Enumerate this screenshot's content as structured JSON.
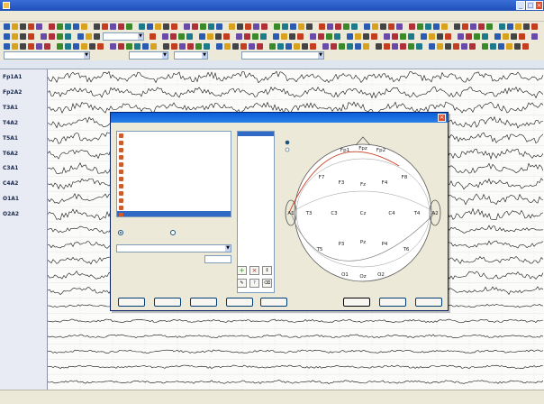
{
  "window": {
    "title": ""
  },
  "menubar": {
    "items": [
      "",
      "",
      "",
      "",
      "",
      "",
      "",
      "",
      "",
      ""
    ]
  },
  "toolbar": {
    "time_select": "",
    "record_select": "",
    "sensitivity_select": "",
    "speed_select": "",
    "montage_select": ""
  },
  "timeline": {
    "left_label": "",
    "ticks": [
      "",
      "",
      "",
      "",
      "",
      "",
      "",
      "",
      "",
      "",
      "",
      "",
      ""
    ]
  },
  "channels": [
    {
      "label": "Fp1A1"
    },
    {
      "label": "Fp2A2"
    },
    {
      "label": "T3A1"
    },
    {
      "label": "T4A2"
    },
    {
      "label": "T5A1"
    },
    {
      "label": "T6A2"
    },
    {
      "label": "C3A1"
    },
    {
      "label": "C4A2"
    },
    {
      "label": "O1A1"
    },
    {
      "label": "O2A2"
    },
    {
      "label": ""
    },
    {
      "label": ""
    },
    {
      "label": ""
    },
    {
      "label": ""
    },
    {
      "label": ""
    },
    {
      "label": ""
    },
    {
      "label": ""
    },
    {
      "label": ""
    },
    {
      "label": ""
    },
    {
      "label": ""
    },
    {
      "label": ""
    }
  ],
  "dialog": {
    "title": "",
    "montages_group_label": "",
    "montages": [
      {
        "label": ""
      },
      {
        "label": ""
      },
      {
        "label": ""
      },
      {
        "label": ""
      },
      {
        "label": ""
      },
      {
        "label": ""
      },
      {
        "label": ""
      },
      {
        "label": ""
      },
      {
        "label": ""
      },
      {
        "label": ""
      },
      {
        "label": ""
      },
      {
        "label": "",
        "selected": true
      }
    ],
    "derivations_label": "",
    "derivations": [
      "",
      "",
      "",
      "",
      "",
      "",
      "",
      "",
      "",
      "",
      "",
      "",
      "",
      "",
      "",
      "",
      "",
      "",
      "",
      "",
      "",
      "",
      "",
      "",
      "",
      "",
      "",
      "",
      "",
      "",
      "",
      "",
      "",
      "",
      "",
      "",
      "",
      "",
      "",
      "",
      "",
      "",
      "",
      "",
      "",
      ""
    ],
    "derivation_type_label": "",
    "monopolar_label": "",
    "bipolar_label": "",
    "reference_label": "",
    "reference_value": "",
    "selected_electrode_label": "",
    "device_setup_label": "",
    "device_setup_lines": [
      "",
      "",
      ""
    ],
    "current_montage_label": "",
    "small_buttons": {
      "add": "+",
      "delete": "×",
      "up": "",
      "down": ""
    },
    "hint_labels": [
      "",
      "",
      "",
      ""
    ],
    "buttons": {
      "new": "",
      "edit": "",
      "delete": "",
      "up": "",
      "down": "",
      "ok": "",
      "cancel": "",
      "help": ""
    },
    "head_options": [
      "",
      ""
    ],
    "electrodes": [
      {
        "label": "Fp1"
      },
      {
        "label": "Fp2"
      },
      {
        "label": "Fpz"
      },
      {
        "label": "F7"
      },
      {
        "label": "F3"
      },
      {
        "label": "Fz"
      },
      {
        "label": "F4"
      },
      {
        "label": "F8"
      },
      {
        "label": "A1"
      },
      {
        "label": "T3"
      },
      {
        "label": "C3"
      },
      {
        "label": "Cz"
      },
      {
        "label": "C4"
      },
      {
        "label": "T4"
      },
      {
        "label": "A2"
      },
      {
        "label": "T5"
      },
      {
        "label": "P3"
      },
      {
        "label": "Pz"
      },
      {
        "label": "P4"
      },
      {
        "label": "T6"
      },
      {
        "label": "O1"
      },
      {
        "label": "Oz"
      },
      {
        "label": "O2"
      }
    ],
    "corner_labels": [
      "",
      "",
      "",
      "",
      "",
      ""
    ]
  },
  "statusbar": {
    "fields": [
      "",
      "",
      "",
      "",
      "",
      "",
      "",
      "",
      "",
      ""
    ]
  },
  "colors": {
    "title_blue": "#1f4fb8",
    "dialog_title_blue": "#0a5fd8",
    "trace_black": "#111111",
    "selection_blue": "#316ac5",
    "electrode_connection_red": "#c8391c"
  }
}
